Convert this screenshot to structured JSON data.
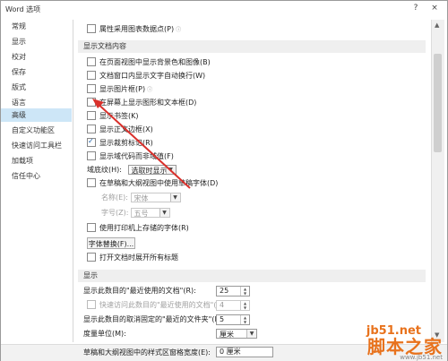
{
  "window": {
    "title": "Word 选项",
    "help": "?",
    "close": "×"
  },
  "sidebar": {
    "items": [
      {
        "label": "常规"
      },
      {
        "label": "显示"
      },
      {
        "label": "校对"
      },
      {
        "label": "保存"
      },
      {
        "label": "版式"
      },
      {
        "label": "语言"
      },
      {
        "label": "高级",
        "selected": true
      },
      {
        "label": "自定义功能区"
      },
      {
        "label": "快速访问工具栏"
      },
      {
        "label": "加载项"
      },
      {
        "label": "信任中心"
      }
    ]
  },
  "top_row": {
    "label": "属性采用图表数据点(P)",
    "checked": false
  },
  "doc_section": {
    "title": "显示文档内容",
    "options": [
      {
        "label": "在页面视图中显示背景色和图像(B)",
        "checked": false
      },
      {
        "label": "文档窗口内显示文字自动换行(W)",
        "checked": false
      },
      {
        "label": "显示图片框(P)",
        "checked": false,
        "info": true
      },
      {
        "label": "在屏幕上显示图形和文本框(D)",
        "checked": false
      },
      {
        "label": "显示书签(K)",
        "checked": false
      },
      {
        "label": "显示正文边框(X)",
        "checked": false
      },
      {
        "label": "显示裁剪标记(R)",
        "checked": true
      },
      {
        "label": "显示域代码而非域值(F)",
        "checked": false
      }
    ],
    "shading_label": "域底纹(H):",
    "shading_value": "选取时显示",
    "draft_font_label": "在草稿和大纲视图中使用草稿字体(D)",
    "name_label": "名称(E):",
    "name_value": "宋体",
    "size_label": "字号(Z):",
    "size_value": "五号",
    "printer_font_label": "使用打印机上存储的字体(R)",
    "font_sub_button": "字体替换(F)...",
    "expand_headings_label": "打开文档时展开所有标题"
  },
  "display_section": {
    "title": "显示",
    "recent_docs_label": "显示此数目的\"最近使用的文档\"(R):",
    "recent_docs_value": "25",
    "quick_access_label": "快速访问此数目的\"最近使用的文档\"(Q):",
    "quick_access_value": "4",
    "unpinned_folders_label": "显示此数目的取消固定的\"最近的文件夹\"(F):",
    "unpinned_folders_value": "5",
    "units_label": "度量单位(M):",
    "units_value": "厘米",
    "style_width_label": "草稿和大纲视图中的样式区窗格宽度(E):",
    "style_width_value": "0 厘米"
  },
  "watermark": {
    "site": "jb51.net",
    "brand": "脚本之家",
    "url": "www.jb51.net"
  },
  "accent": "#cde6f7",
  "arrow_color": "#d9302b"
}
